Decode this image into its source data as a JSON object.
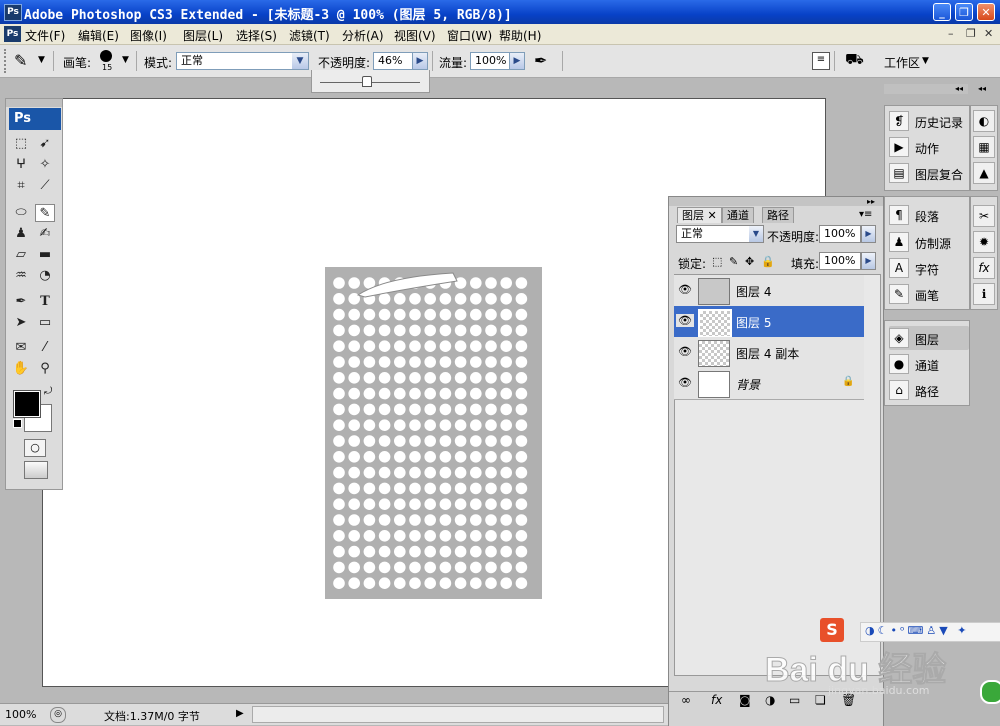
{
  "window": {
    "title": "Adobe Photoshop CS3 Extended - [未标题-3 @ 100% (图层 5, RGB/8)]",
    "app_icon": "Ps"
  },
  "menu": {
    "items": [
      "文件(F)",
      "编辑(E)",
      "图像(I)",
      "图层(L)",
      "选择(S)",
      "滤镜(T)",
      "分析(A)",
      "视图(V)",
      "窗口(W)",
      "帮助(H)"
    ]
  },
  "options": {
    "brush_label": "画笔:",
    "brush_size": "15",
    "mode_label": "模式:",
    "mode_value": "正常",
    "opacity_label": "不透明度:",
    "opacity_value": "46%",
    "flow_label": "流量:",
    "flow_value": "100%",
    "workspace_label": "工作区",
    "opacity_slider_level": 0.46
  },
  "toolbox": {
    "logo": "Ps",
    "tools": [
      "marquee",
      "move",
      "lasso",
      "magic-wand",
      "crop",
      "slice",
      "healing",
      "brush",
      "stamp",
      "history-brush",
      "eraser",
      "gradient",
      "blur",
      "dodge",
      "pen",
      "type",
      "path-select",
      "shape",
      "notes",
      "eyedropper",
      "hand",
      "zoom"
    ]
  },
  "status": {
    "zoom": "100%",
    "doc": "文档:1.37M/0 字节"
  },
  "layers_panel": {
    "tabs": [
      "图层",
      "通道",
      "路径"
    ],
    "blend_mode": "正常",
    "opacity_label": "不透明度:",
    "opacity_value": "100%",
    "lock_label": "锁定:",
    "fill_label": "填充:",
    "fill_value": "100%",
    "layers": [
      {
        "name": "图层 4",
        "selected": false
      },
      {
        "name": "图层 5",
        "selected": true
      },
      {
        "name": "图层 4 副本",
        "selected": false
      },
      {
        "name": "背景",
        "selected": false,
        "locked": true
      }
    ]
  },
  "dock": {
    "group1": [
      "历史记录",
      "动作",
      "图层复合"
    ],
    "group2": [
      "段落",
      "仿制源",
      "字符",
      "画笔"
    ],
    "group3": [
      "图层",
      "通道",
      "路径"
    ]
  },
  "watermark": {
    "brand": "Bai du 经验",
    "url": "jingyan.baidu.com"
  },
  "colors": {
    "title_bar": "#0a46c8",
    "selection": "#3a6bc8",
    "foreground": "#000000",
    "background": "#ffffff",
    "dot_panel": "#b0b0b0"
  }
}
